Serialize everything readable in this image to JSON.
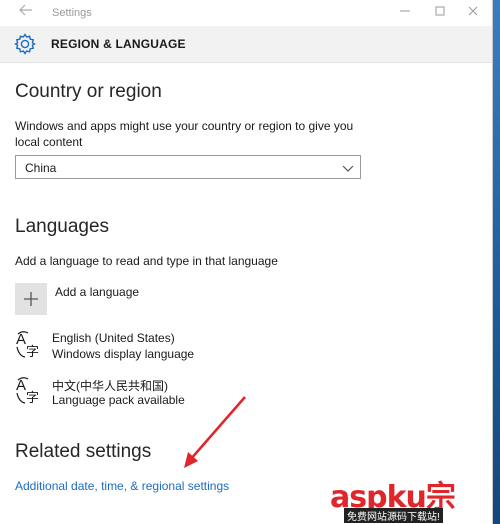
{
  "window": {
    "title": "Settings",
    "controls": {
      "back": "back-icon",
      "minimize": "minimize-icon",
      "maximize": "maximize-icon",
      "close": "close-icon"
    }
  },
  "header": {
    "title": "REGION & LANGUAGE",
    "icon": "gear-icon"
  },
  "country": {
    "heading": "Country or region",
    "description": "Windows and apps might use your country or region to give you local content",
    "selected": "China"
  },
  "languages": {
    "heading": "Languages",
    "description": "Add a language to read and type in that language",
    "add_label": "Add a language",
    "items": [
      {
        "name": "English (United States)",
        "status": "Windows display language"
      },
      {
        "name": "中文(中华人民共和国)",
        "status": "Language pack available"
      }
    ]
  },
  "related": {
    "heading": "Related settings",
    "link": "Additional date, time, & regional settings"
  },
  "watermark": {
    "brand": "aspku",
    "mark": "宗",
    "subtitle": "免费网站源码下载站!"
  },
  "colors": {
    "accent": "#1c6cc4",
    "header_bg": "#f2f2f2",
    "annotation_arrow": "#e0262a"
  }
}
